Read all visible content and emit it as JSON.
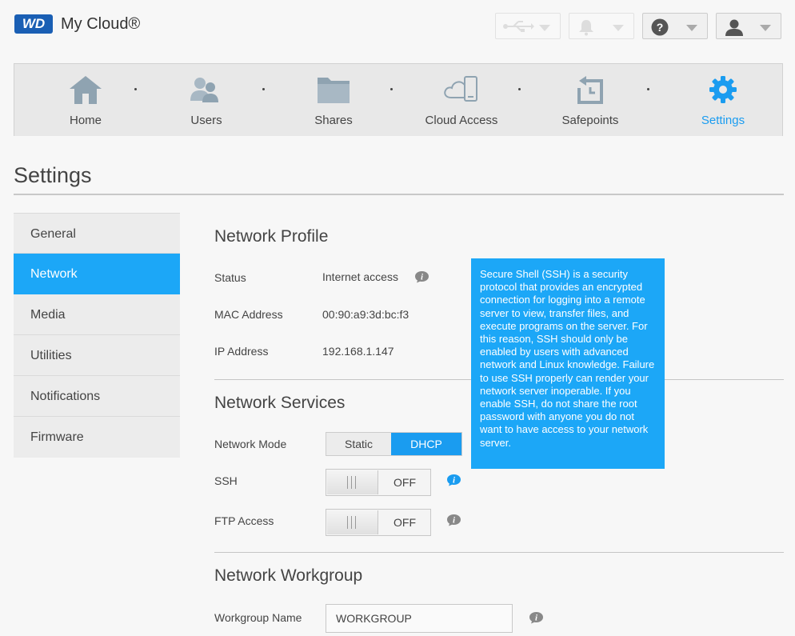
{
  "header": {
    "logo_text": "WD",
    "app_name": "My Cloud®"
  },
  "toolbar": {
    "usb_icon": "usb-icon",
    "alerts_icon": "bell-icon",
    "help_icon": "help-icon",
    "user_icon": "user-icon"
  },
  "nav": {
    "items": [
      {
        "label": "Home",
        "icon": "home-icon"
      },
      {
        "label": "Users",
        "icon": "users-icon"
      },
      {
        "label": "Shares",
        "icon": "folder-icon"
      },
      {
        "label": "Cloud Access",
        "icon": "cloud-access-icon"
      },
      {
        "label": "Safepoints",
        "icon": "safepoint-icon"
      },
      {
        "label": "Settings",
        "icon": "gear-icon",
        "active": true
      }
    ],
    "accent_color": "#1a9cf0"
  },
  "page": {
    "title": "Settings"
  },
  "sidebar": {
    "items": [
      {
        "label": "General"
      },
      {
        "label": "Network",
        "active": true
      },
      {
        "label": "Media"
      },
      {
        "label": "Utilities"
      },
      {
        "label": "Notifications"
      },
      {
        "label": "Firmware"
      }
    ]
  },
  "network_profile": {
    "title": "Network Profile",
    "status_label": "Status",
    "status_value": "Internet access",
    "mac_label": "MAC Address",
    "mac_value": "00:90:a9:3d:bc:f3",
    "ip_label": "IP Address",
    "ip_value": "192.168.1.147"
  },
  "network_services": {
    "title": "Network Services",
    "mode_label": "Network Mode",
    "mode_options": [
      "Static",
      "DHCP"
    ],
    "mode_selected": "DHCP",
    "ssh_label": "SSH",
    "ssh_state": "OFF",
    "ftp_label": "FTP Access",
    "ftp_state": "OFF"
  },
  "network_workgroup": {
    "title": "Network Workgroup",
    "name_label": "Workgroup Name",
    "name_value": "WORKGROUP"
  },
  "tooltip": {
    "text": "Secure Shell (SSH) is a security protocol that provides an encrypted connection for logging into a remote server to view, transfer files, and execute programs on the server. For this reason, SSH should only be enabled by users with advanced network and Linux knowledge. Failure to use SSH properly can render your network server inoperable. If you enable SSH, do not share the root password with anyone you do not want to have access to your network server."
  }
}
